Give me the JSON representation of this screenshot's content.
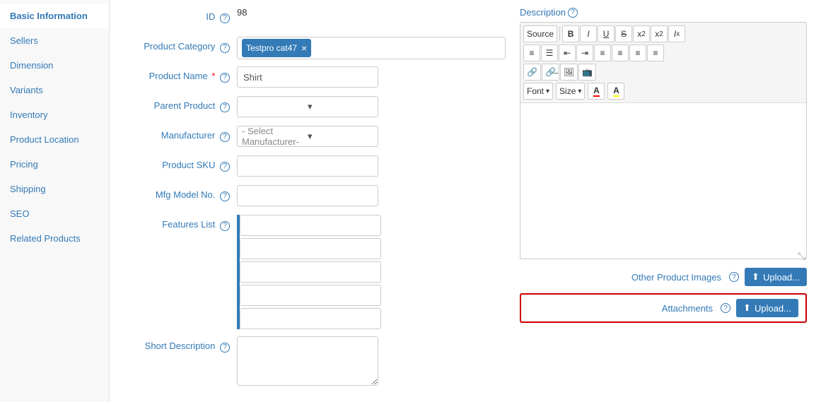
{
  "sidebar": {
    "items": [
      {
        "label": "Basic Information",
        "active": true
      },
      {
        "label": "Sellers",
        "active": false
      },
      {
        "label": "Dimension",
        "active": false
      },
      {
        "label": "Variants",
        "active": false
      },
      {
        "label": "Inventory",
        "active": false
      },
      {
        "label": "Product Location",
        "active": false
      },
      {
        "label": "Pricing",
        "active": false
      },
      {
        "label": "Shipping",
        "active": false
      },
      {
        "label": "SEO",
        "active": false
      },
      {
        "label": "Related Products",
        "active": false
      }
    ]
  },
  "form": {
    "id_label": "ID",
    "id_value": "98",
    "product_category_label": "Product Category",
    "product_category_tag": "Testpro cat47",
    "product_name_label": "Product Name",
    "product_name_value": "Shirt",
    "parent_product_label": "Parent Product",
    "manufacturer_label": "Manufacturer",
    "manufacturer_placeholder": "- Select Manufacturer-",
    "product_sku_label": "Product SKU",
    "mfg_model_label": "Mfg Model No.",
    "features_list_label": "Features List",
    "short_description_label": "Short Description",
    "description_label": "Description"
  },
  "toolbar": {
    "source_label": "Source",
    "bold": "B",
    "italic": "I",
    "underline": "U",
    "strikethrough": "S",
    "subscript": "x",
    "subscript_suffix": "₂",
    "superscript": "x",
    "superscript_suffix": "²",
    "clear_format": "Ix",
    "font_label": "Font",
    "size_label": "Size",
    "font_color": "A",
    "bg_color": "A"
  },
  "buttons": {
    "upload_label": "Upload...",
    "other_product_images_label": "Other Product Images",
    "attachments_label": "Attachments"
  },
  "icons": {
    "upload": "⬆",
    "help": "?",
    "chevron_down": "▾",
    "remove": "×"
  }
}
